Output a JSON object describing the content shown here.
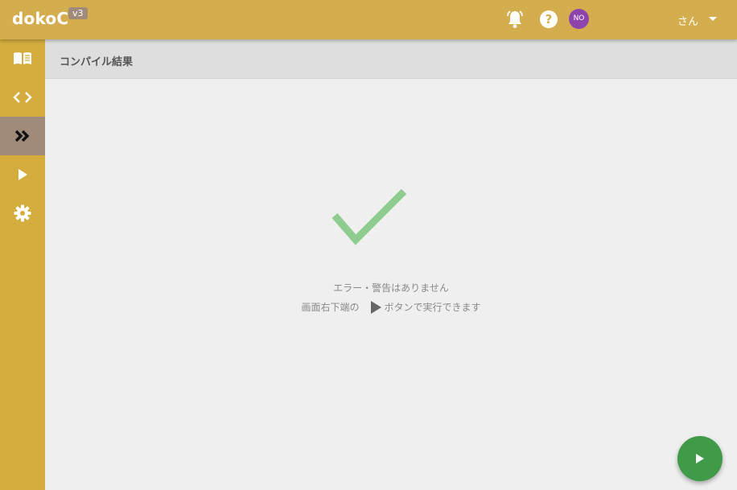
{
  "app": {
    "logo": "dokoC",
    "version": "v3"
  },
  "topbar": {
    "bell_icon": "bell-icon",
    "help_icon": "help-circle-icon",
    "help_glyph": "?",
    "avatar_initials": "NO",
    "user_label": "さん"
  },
  "sidebar": {
    "items": [
      {
        "id": "book",
        "icon": "book-icon",
        "active": false
      },
      {
        "id": "code",
        "icon": "code-icon",
        "active": false
      },
      {
        "id": "compile",
        "icon": "double-chevron-right-icon",
        "active": true
      },
      {
        "id": "run",
        "icon": "play-icon",
        "active": false
      },
      {
        "id": "settings",
        "icon": "gear-icon",
        "active": false
      }
    ]
  },
  "main": {
    "title": "コンパイル結果",
    "message_line1": "エラー・警告はありません",
    "message_line2_before": "画面右下端の",
    "message_line2_after": "ボタンで実行できます"
  },
  "colors": {
    "topbar": "#d4ad4f",
    "sidebar": "#d4ad3e",
    "active_item": "#a08a7a",
    "check": "#8fcc8f",
    "fab": "#3f9b47",
    "avatar": "#8e44ad"
  }
}
